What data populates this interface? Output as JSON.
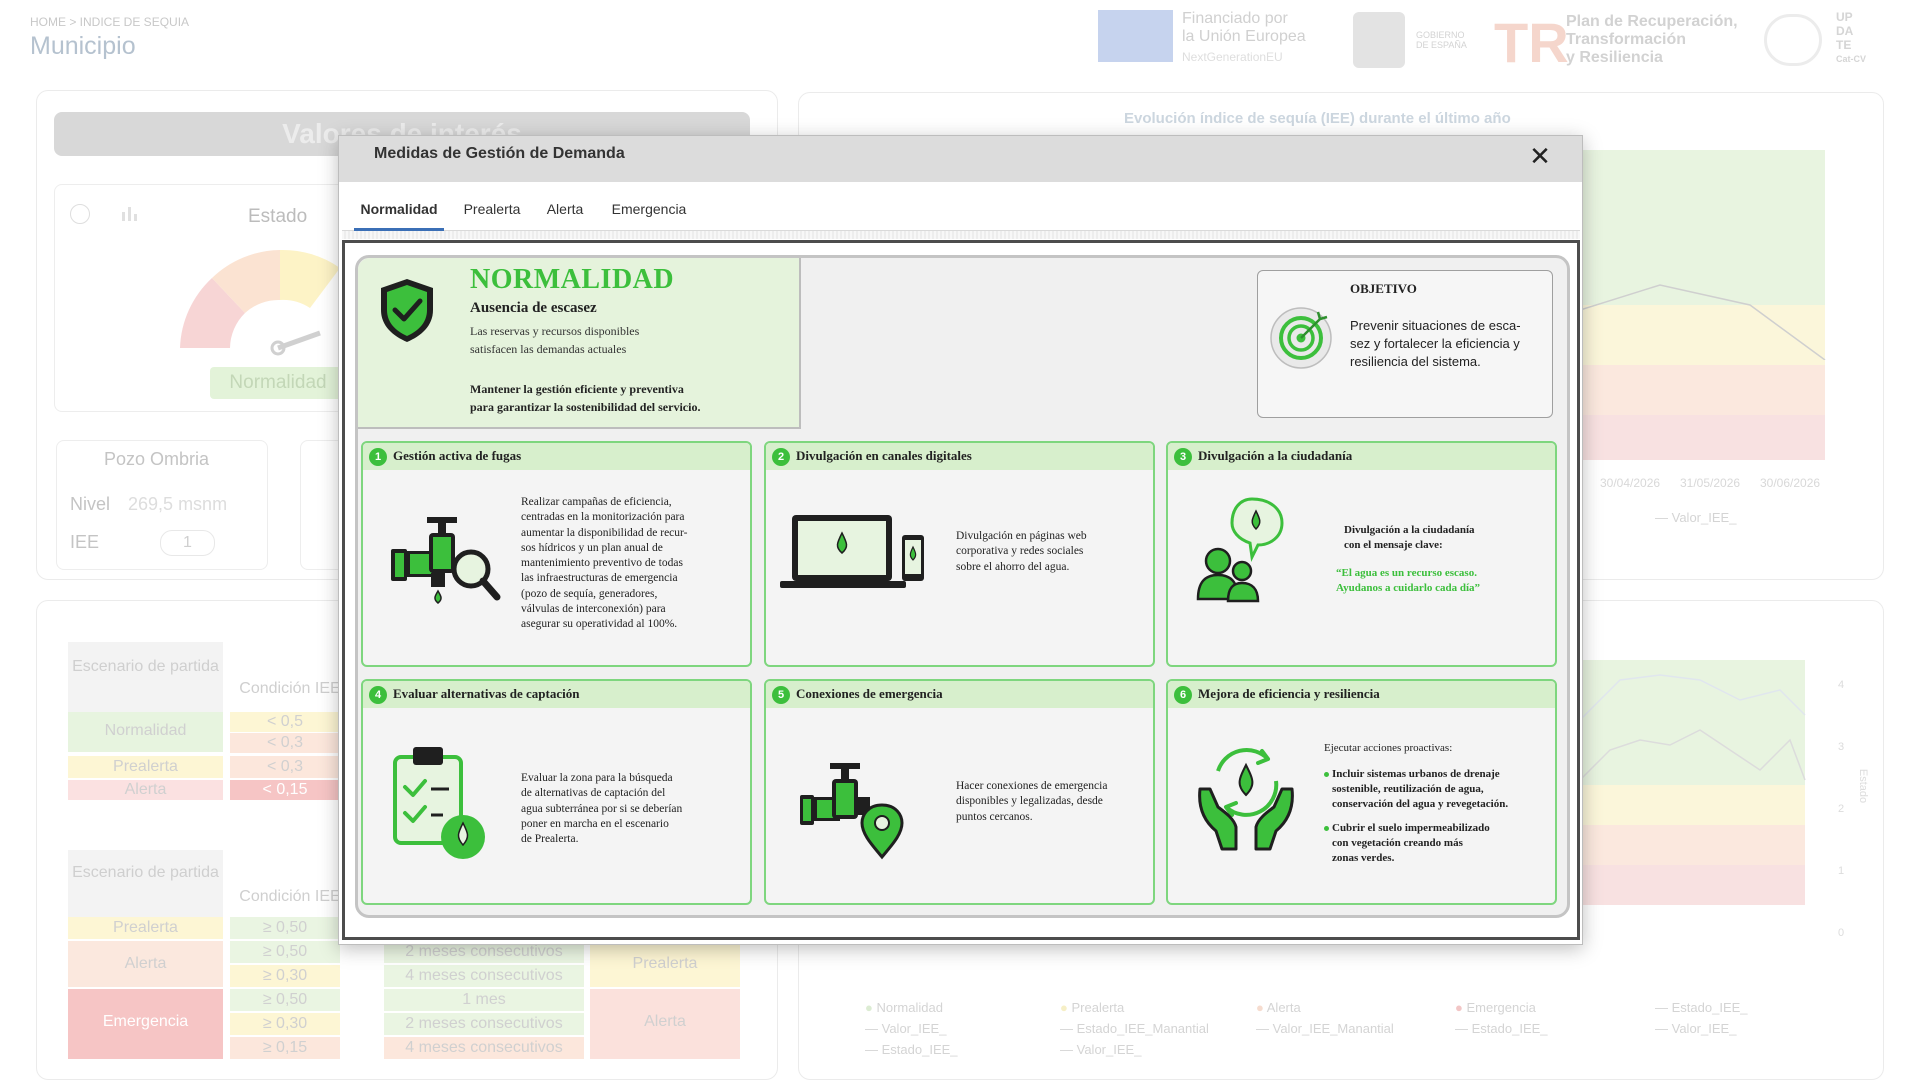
{
  "background": {
    "breadcrumb": "HOME > INDICE DE SEQUIA",
    "page_title": "Municipio",
    "logos": {
      "eu_line1": "Financiado por",
      "eu_line2": "la Unión Europea",
      "eu_sub": "NextGenerationEU",
      "gov_text": "GOBIERNO DE ESPAÑA",
      "plan_mark": "TR",
      "plan_line1": "Plan de Recuperación,",
      "plan_line2": "Transformación",
      "plan_line3": "y Resiliencia",
      "upd_line1": "UP",
      "upd_line2": "DA",
      "upd_line3": "TE",
      "upd_line4": "Cat-CV"
    },
    "valores_title": "Valores de interés",
    "estado_label": "Estado",
    "gauge_value": "Normalidad",
    "pozo": {
      "title": "Pozo Ombria",
      "nivel_label": "Nivel",
      "nivel_value": "269,5",
      "nivel_unit": "msnm",
      "iee_label": "IEE",
      "iee_value": "1"
    },
    "chart_title": "Evolución índice de sequía (IEE) durante el último año",
    "chart_dates": [
      "30/04/2026",
      "31/05/2026",
      "30/06/2026"
    ],
    "chart_legend": "Valor_IEE_",
    "scenario_table_1": {
      "header_1": "Escenario de partida",
      "header_2": "Condición IEE",
      "rows": [
        {
          "scenario": "Normalidad",
          "conds": [
            "< 0,5",
            "< 0,3"
          ]
        },
        {
          "scenario": "Prealerta",
          "conds": [
            "< 0,3"
          ]
        },
        {
          "scenario": "Alerta",
          "conds": [
            "< 0,15"
          ]
        }
      ]
    },
    "scenario_table_2": {
      "header_1": "Escenario de partida",
      "header_2": "Condición IEE",
      "rows": [
        {
          "scenario": "Prealerta",
          "conds": [
            "≥ 0,50"
          ],
          "durations": [
            ""
          ],
          "target": ""
        },
        {
          "scenario": "Alerta",
          "conds": [
            "≥ 0,50",
            "≥ 0,30"
          ],
          "durations": [
            "2 meses consecutivos",
            "4 meses consecutivos"
          ],
          "target": "Prealerta"
        },
        {
          "scenario": "Emergencia",
          "conds": [
            "≥ 0,50",
            "≥ 0,30",
            "≥ 0,15"
          ],
          "durations": [
            "1 mes",
            "2 meses consecutivos",
            "4 meses consecutivos"
          ],
          "target": "Alerta"
        }
      ]
    },
    "bottom_legend": [
      "Normalidad",
      "Prealerta",
      "Alerta",
      "Emergencia",
      "Estado_IEE_",
      "Valor_IEE_",
      "Estado_IEE_Manantial",
      "Valor_IEE_Manantial",
      "Estado_IEE_",
      "Valor_IEE_",
      "Estado_IEE_",
      "Valor_IEE_"
    ],
    "right_axis_label": "Estado",
    "right_axis_ticks": [
      "4",
      "3",
      "2",
      "1",
      "0"
    ]
  },
  "modal": {
    "title": "Medidas de Gestión de Demanda",
    "close_symbol": "✕",
    "tabs": [
      "Normalidad",
      "Prealerta",
      "Alerta",
      "Emergencia"
    ],
    "active_tab": "Normalidad"
  },
  "infographic": {
    "status_title": "NORMALIDAD",
    "status_subtitle": "Ausencia de escasez",
    "status_desc_1": "Las reservas y recursos disponibles",
    "status_desc_2": "satisfacen las demandas actuales",
    "status_note_1": "Mantener la gestión eficiente y preventiva",
    "status_note_2": "para garantizar la sostenibilidad del servicio.",
    "objective_title": "OBJETIVO",
    "objective_lines": [
      "Prevenir situaciones de esca-",
      "sez y fortalecer la eficiencia y",
      "resiliencia del sistema."
    ],
    "measures": [
      {
        "num": "1",
        "title": "Gestión activa de fugas",
        "icon": "tap-magnifier-icon",
        "lines": [
          "Realizar campañas de eficiencia,",
          "centradas en la monitorización para",
          "aumentar la disponibilidad de recur-",
          "sos hídricos y un plan anual de",
          "mantenimiento preventivo de todas",
          "las infraestructuras de emergencia",
          "(pozo de sequía, generadores,",
          "válvulas de interconexión) para",
          "asegurar su operatividad al 100%."
        ]
      },
      {
        "num": "2",
        "title": "Divulgación en canales digitales",
        "icon": "laptop-phone-icon",
        "lines": [
          "Divulgación en páginas web",
          "corporativa y redes sociales",
          "sobre el ahorro del agua."
        ]
      },
      {
        "num": "3",
        "title": "Divulgación a la ciudadanía",
        "icon": "people-speech-icon",
        "lines": [
          "Divulgación a la ciudadanía",
          "con el mensaje clave:"
        ],
        "quote": [
          "“El agua es un recurso escaso.",
          "Ayudanos a cuidarlo cada día”"
        ]
      },
      {
        "num": "4",
        "title": "Evaluar alternativas de captación",
        "icon": "clipboard-check-icon",
        "lines": [
          "Evaluar la zona para la búsqueda",
          "de alternativas de captación del",
          "agua subterránea por si se deberían",
          "poner en marcha en el escenario",
          "de Prealerta."
        ]
      },
      {
        "num": "5",
        "title": "Conexiones de emergencia",
        "icon": "tap-location-icon",
        "lines": [
          "Hacer conexiones de emergencia",
          "disponibles y legalizadas, desde",
          "puntos cercanos."
        ]
      },
      {
        "num": "6",
        "title": "Mejora de eficiencia y resiliencia",
        "icon": "hands-water-cycle-icon",
        "intro": "Ejecutar acciones proactivas:",
        "bullet_1": [
          "Incluir sistemas urbanos de drenaje",
          "sostenible, reutilización de agua,",
          "conservación del agua y revegetación."
        ],
        "bullet_2": [
          "Cubrir el suelo impermeabilizado",
          "con vegetación creando más",
          "zonas verdes."
        ]
      }
    ],
    "colors": {
      "green": "#3cbf3c",
      "light_green": "#e5f3dc",
      "header_green": "#d7efcc"
    }
  }
}
